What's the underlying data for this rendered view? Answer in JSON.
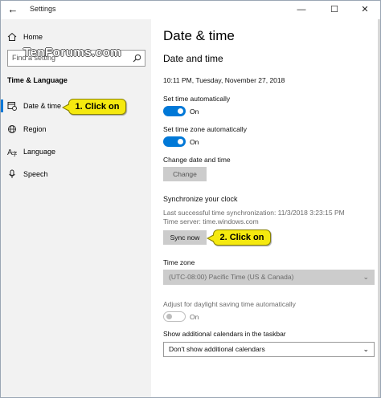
{
  "window": {
    "title": "Settings",
    "back_icon": "back-arrow-icon",
    "controls": [
      "minimize",
      "maximize",
      "close"
    ]
  },
  "watermark": "TenForums.com",
  "sidebar": {
    "home": "Home",
    "search_placeholder": "Find a setting",
    "section": "Time & Language",
    "items": [
      {
        "label": "Date & time",
        "icon": "calendar-clock-icon",
        "active": true
      },
      {
        "label": "Region",
        "icon": "globe-icon",
        "active": false
      },
      {
        "label": "Language",
        "icon": "language-icon",
        "active": false
      },
      {
        "label": "Speech",
        "icon": "microphone-icon",
        "active": false
      }
    ]
  },
  "main": {
    "page_title": "Date & time",
    "section_title": "Date and time",
    "current_time": "10:11 PM, Tuesday, November 27, 2018",
    "set_time_auto": {
      "label": "Set time automatically",
      "state": "On"
    },
    "set_zone_auto": {
      "label": "Set time zone automatically",
      "state": "On"
    },
    "change_date": {
      "label": "Change date and time",
      "button": "Change"
    },
    "sync": {
      "heading": "Synchronize your clock",
      "last_sync": "Last successful time synchronization: 11/3/2018 3:23:15 PM",
      "server": "Time server: time.windows.com",
      "button": "Sync now"
    },
    "time_zone": {
      "label": "Time zone",
      "value": "(UTC-08:00) Pacific Time (US & Canada)"
    },
    "dst": {
      "label": "Adjust for daylight saving time automatically",
      "state": "On"
    },
    "calendars": {
      "label": "Show additional calendars in the taskbar",
      "value": "Don't show additional calendars"
    }
  },
  "callouts": {
    "first": "1. Click on",
    "second": "2. Click on"
  },
  "colors": {
    "accent": "#0078d7",
    "callout": "#f5e90f",
    "sidebar_bg": "#f2f2f2"
  }
}
